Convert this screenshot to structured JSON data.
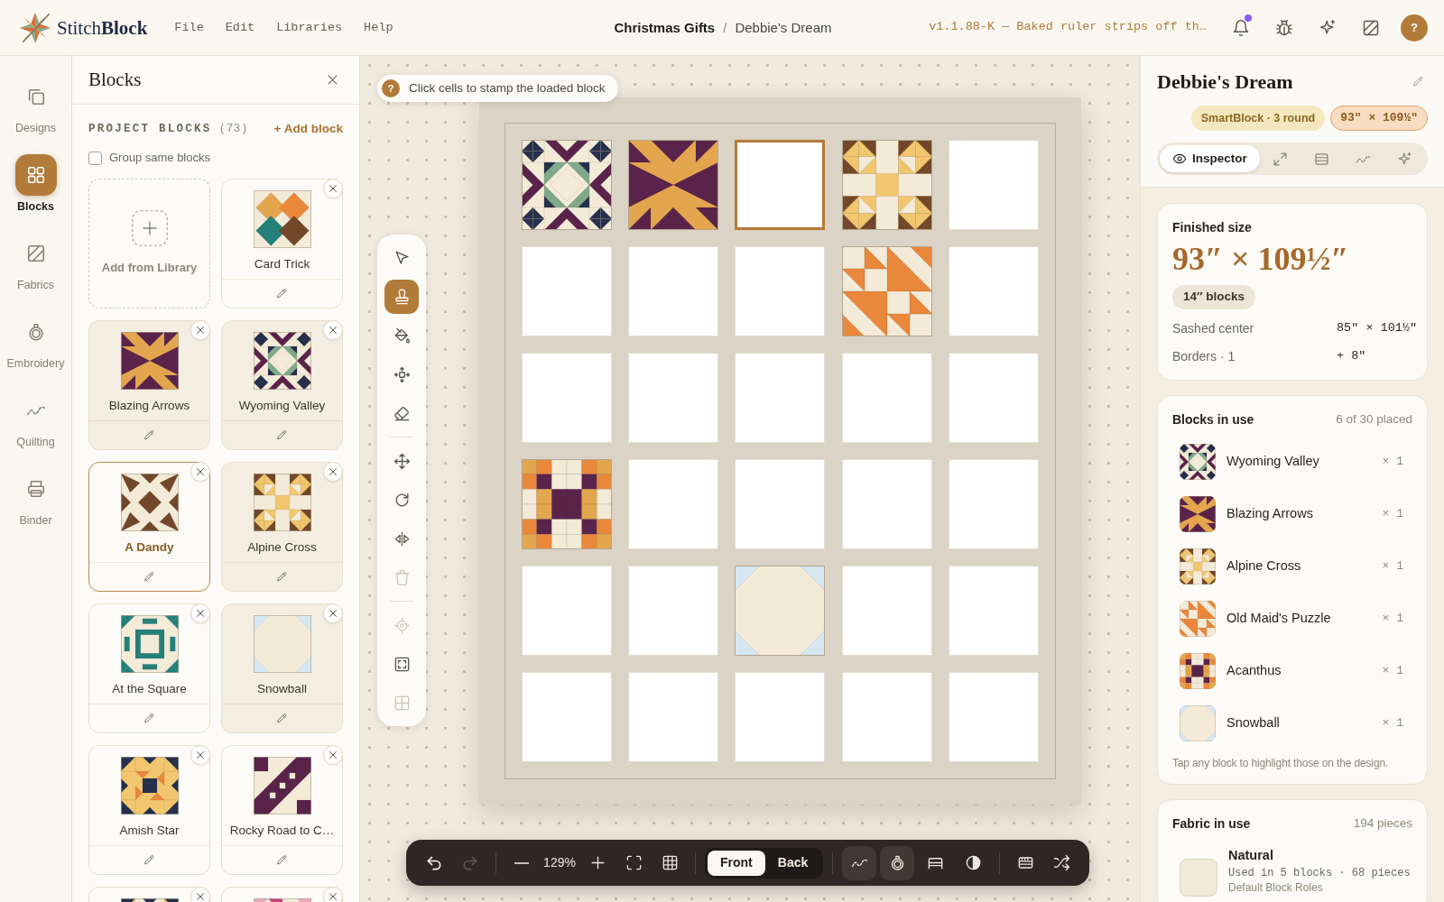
{
  "header": {
    "logo": "Stitch**Block**",
    "menu": [
      {
        "label": "File"
      },
      {
        "label": "Edit"
      },
      {
        "label": "Libraries"
      },
      {
        "label": "Help"
      }
    ],
    "breadcrumb": [
      {
        "label": "Christmas Gifts",
        "current": false
      },
      {
        "label": "Debbie's Dream",
        "current": true
      }
    ],
    "breadcrumb_separator": "/",
    "version_note": "v1.1.88-K — Baked ruler strips off th…",
    "actions": [
      {
        "kind": "bell",
        "badge": true
      },
      {
        "kind": "bug",
        "badge": false
      },
      {
        "kind": "sparkle",
        "badge": false
      },
      {
        "kind": "fabric",
        "badge": false
      }
    ],
    "avatar": {
      "label": "?"
    }
  },
  "nav": [
    {
      "kind": "designs",
      "label": "Designs",
      "selected": false
    },
    {
      "kind": "blocks",
      "label": "Blocks",
      "selected": true
    },
    {
      "kind": "fabrics",
      "label": "Fabrics",
      "selected": false
    },
    {
      "kind": "embroidery",
      "label": "Embroidery",
      "selected": false
    },
    {
      "kind": "quilting",
      "label": "Quilting",
      "selected": false
    },
    {
      "kind": "binder",
      "label": "Binder",
      "selected": false
    }
  ],
  "blocks_panel": {
    "title": "Blocks",
    "section": "PROJECT BLOCKS",
    "count": "(73)",
    "add_action": "+ Add block",
    "group_toggle": {
      "label": "Group same blocks",
      "checked": false
    },
    "library_tile": {
      "label": "Add from Library"
    },
    "cards": [
      {
        "name": "Card Trick",
        "kind": "cardtrick",
        "in_use": false,
        "selected": false
      },
      {
        "name": "Blazing Arrows",
        "kind": "arrows",
        "in_use": true,
        "selected": false
      },
      {
        "name": "Wyoming Valley",
        "kind": "wyoming",
        "in_use": true,
        "selected": false
      },
      {
        "name": "A Dandy",
        "kind": "dandy",
        "in_use": false,
        "selected": true
      },
      {
        "name": "Alpine Cross",
        "kind": "alpine",
        "in_use": true,
        "selected": false
      },
      {
        "name": "At the Square",
        "kind": "square",
        "in_use": false,
        "selected": false
      },
      {
        "name": "Snowball",
        "kind": "snowball",
        "in_use": true,
        "selected": false
      },
      {
        "name": "Amish Star",
        "kind": "amish",
        "in_use": false,
        "selected": false
      },
      {
        "name": "Rocky Road to C…",
        "kind": "rocky",
        "in_use": false,
        "selected": false
      },
      {
        "kind": "sawtooth",
        "in_use": false,
        "selected": false
      },
      {
        "kind": "pinkstar",
        "in_use": false,
        "selected": false
      }
    ]
  },
  "canvas": {
    "hint": {
      "icon": "?",
      "text": "Click cells to stamp the loaded block"
    },
    "tools": [
      [
        {
          "kind": "pointer",
          "selected": false,
          "disabled": false
        },
        {
          "kind": "stamp",
          "selected": true,
          "disabled": false
        },
        {
          "kind": "fill",
          "selected": false,
          "disabled": false
        },
        {
          "kind": "nudge",
          "selected": false,
          "disabled": false
        },
        {
          "kind": "eraser",
          "selected": false,
          "disabled": false
        }
      ],
      [
        {
          "kind": "move",
          "selected": false,
          "disabled": false
        },
        {
          "kind": "rotate",
          "selected": false,
          "disabled": false
        },
        {
          "kind": "flip",
          "selected": false,
          "disabled": false
        },
        {
          "kind": "delete",
          "selected": false,
          "disabled": true
        }
      ],
      [
        {
          "kind": "locate",
          "selected": false,
          "disabled": true
        },
        {
          "kind": "frame",
          "selected": false,
          "disabled": false
        },
        {
          "kind": "layout",
          "selected": false,
          "disabled": true
        }
      ]
    ],
    "quilt": {
      "rows": [
        [
          {
            "kind": "wyoming",
            "selected": false
          },
          {
            "kind": "arrows",
            "selected": false
          },
          {
            "kind": "empty",
            "selected": true
          },
          {
            "kind": "alpine",
            "selected": false
          },
          {
            "kind": "empty",
            "selected": false
          }
        ],
        [
          {
            "kind": "empty",
            "selected": false
          },
          {
            "kind": "empty",
            "selected": false
          },
          {
            "kind": "empty",
            "selected": false
          },
          {
            "kind": "puzzle",
            "selected": false
          },
          {
            "kind": "empty",
            "selected": false
          }
        ],
        [
          {
            "kind": "empty",
            "selected": false
          },
          {
            "kind": "empty",
            "selected": false
          },
          {
            "kind": "empty",
            "selected": false
          },
          {
            "kind": "empty",
            "selected": false
          },
          {
            "kind": "empty",
            "selected": false
          }
        ],
        [
          {
            "kind": "acanthus",
            "selected": false
          },
          {
            "kind": "empty",
            "selected": false
          },
          {
            "kind": "empty",
            "selected": false
          },
          {
            "kind": "empty",
            "selected": false
          },
          {
            "kind": "empty",
            "selected": false
          }
        ],
        [
          {
            "kind": "empty",
            "selected": false
          },
          {
            "kind": "empty",
            "selected": false
          },
          {
            "kind": "snowball",
            "selected": false
          },
          {
            "kind": "empty",
            "selected": false
          },
          {
            "kind": "empty",
            "selected": false
          }
        ],
        [
          {
            "kind": "empty",
            "selected": false
          },
          {
            "kind": "empty",
            "selected": false
          },
          {
            "kind": "empty",
            "selected": false
          },
          {
            "kind": "empty",
            "selected": false
          },
          {
            "kind": "empty",
            "selected": false
          }
        ]
      ]
    }
  },
  "toolbar": {
    "history": [
      {
        "kind": "undo",
        "disabled": false
      },
      {
        "kind": "redo",
        "disabled": true
      }
    ],
    "zoom": {
      "value": "129%"
    },
    "view": [
      {
        "kind": "fit"
      },
      {
        "kind": "grid"
      }
    ],
    "sides": [
      {
        "label": "Front",
        "selected": true
      },
      {
        "label": "Back",
        "selected": false
      }
    ],
    "layers": [
      {
        "kind": "quilting",
        "on": true
      },
      {
        "kind": "embroidery",
        "on": true
      },
      {
        "kind": "bed",
        "on": false
      },
      {
        "kind": "contrast",
        "on": false
      }
    ],
    "extras": [
      {
        "kind": "ruler"
      },
      {
        "kind": "shuffle"
      }
    ]
  },
  "inspector": {
    "title": "Debbie's Dream",
    "badges": [
      {
        "kind": "type",
        "label": "SmartBlock · 3 round"
      },
      {
        "kind": "size",
        "label": "93″ × 109½″"
      }
    ],
    "tabs": [
      {
        "kind": "inspector",
        "label": "Inspector",
        "selected": true
      },
      {
        "kind": "resize",
        "selected": false
      },
      {
        "kind": "rows",
        "selected": false
      },
      {
        "kind": "quilting",
        "selected": false
      },
      {
        "kind": "sparkle",
        "selected": false
      }
    ],
    "finished_size": {
      "title": "Finished size",
      "value": "93″ × 109½″",
      "chip": "14″ blocks",
      "rows": [
        {
          "label": "Sashed center",
          "value": "85″ × 101½″"
        },
        {
          "label": "Borders · 1",
          "value": "+ 8″"
        }
      ]
    },
    "blocks_in_use": {
      "title": "Blocks in use",
      "count": "6 of 30 placed",
      "items": [
        {
          "name": "Wyoming Valley",
          "kind": "wyoming",
          "count": "× 1"
        },
        {
          "name": "Blazing Arrows",
          "kind": "arrows",
          "count": "× 1"
        },
        {
          "name": "Alpine Cross",
          "kind": "alpine",
          "count": "× 1"
        },
        {
          "name": "Old Maid's Puzzle",
          "kind": "puzzle",
          "count": "× 1"
        },
        {
          "name": "Acanthus",
          "kind": "acanthus",
          "count": "× 1"
        },
        {
          "name": "Snowball",
          "kind": "snowball",
          "count": "× 1"
        }
      ],
      "note": "Tap any block to highlight those on the design."
    },
    "fabric_in_use": {
      "title": "Fabric in use",
      "count": "194 pieces",
      "items": [
        {
          "name": "Natural",
          "color": "#f2e9d8",
          "usage": "Used in 5 blocks · 68 pieces",
          "role": "Default Block Roles"
        }
      ]
    }
  }
}
